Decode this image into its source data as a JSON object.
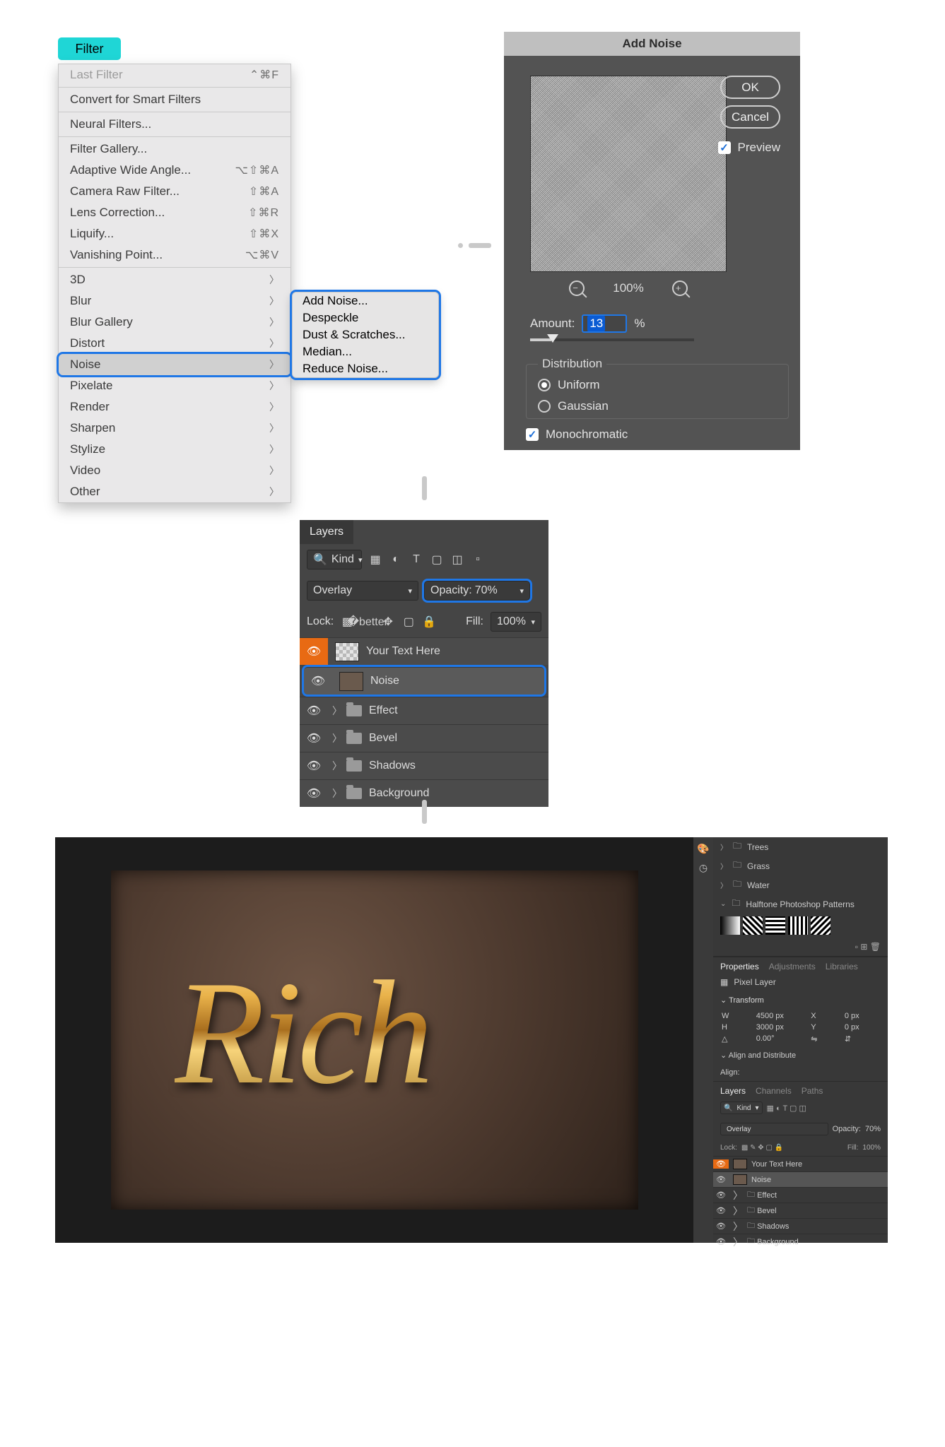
{
  "filter_button": "Filter",
  "menu": {
    "last_filter": "Last Filter",
    "last_filter_kbd": "⌃⌘F",
    "convert": "Convert for Smart Filters",
    "neural": "Neural Filters...",
    "gallery": "Filter Gallery...",
    "adaptive": "Adaptive Wide Angle...",
    "adaptive_kbd": "⌥⇧⌘A",
    "camera": "Camera Raw Filter...",
    "camera_kbd": "⇧⌘A",
    "lens": "Lens Correction...",
    "lens_kbd": "⇧⌘R",
    "liquify": "Liquify...",
    "liquify_kbd": "⇧⌘X",
    "vanish": "Vanishing Point...",
    "vanish_kbd": "⌥⌘V",
    "groups": [
      "3D",
      "Blur",
      "Blur Gallery",
      "Distort",
      "Noise",
      "Pixelate",
      "Render",
      "Sharpen",
      "Stylize",
      "Video",
      "Other"
    ]
  },
  "submenu": [
    "Add Noise...",
    "Despeckle",
    "Dust & Scratches...",
    "Median...",
    "Reduce Noise..."
  ],
  "dialog": {
    "title": "Add Noise",
    "ok": "OK",
    "cancel": "Cancel",
    "preview": "Preview",
    "zoom": "100%",
    "amount_label": "Amount:",
    "amount_value": "13",
    "pct": "%",
    "distribution": "Distribution",
    "uniform": "Uniform",
    "gaussian": "Gaussian",
    "mono": "Monochromatic"
  },
  "layers_panel": {
    "tab": "Layers",
    "kind": "Kind",
    "blend": "Overlay",
    "opacity_label": "Opacity:",
    "opacity_value": "70%",
    "lock": "Lock:",
    "fill_label": "Fill:",
    "fill_value": "100%",
    "layers": [
      "Your Text Here",
      "Noise",
      "Effect",
      "Bevel",
      "Shadows",
      "Background"
    ]
  },
  "workspace": {
    "text": "Rich",
    "patterns": {
      "trees": "Trees",
      "grass": "Grass",
      "water": "Water",
      "halftone": "Halftone Photoshop Patterns"
    },
    "panel_tabs": {
      "properties": "Properties",
      "adjustments": "Adjustments",
      "libraries": "Libraries"
    },
    "pixel_layer": "Pixel Layer",
    "transform": "Transform",
    "w": "W",
    "w_val": "4500 px",
    "x": "X",
    "x_val": "0 px",
    "h": "H",
    "h_val": "3000 px",
    "y": "Y",
    "y_val": "0 px",
    "angle": "0.00°",
    "align": "Align and Distribute",
    "align_lbl": "Align:",
    "ltab": {
      "layers": "Layers",
      "channels": "Channels",
      "paths": "Paths"
    },
    "kind": "Kind",
    "blend": "Overlay",
    "op_lbl": "Opacity:",
    "op_val": "70%",
    "lock": "Lock:",
    "fill_lbl": "Fill:",
    "fill_val": "100%",
    "mlayers": [
      "Your Text Here",
      "Noise",
      "Effect",
      "Bevel",
      "Shadows",
      "Background"
    ]
  }
}
